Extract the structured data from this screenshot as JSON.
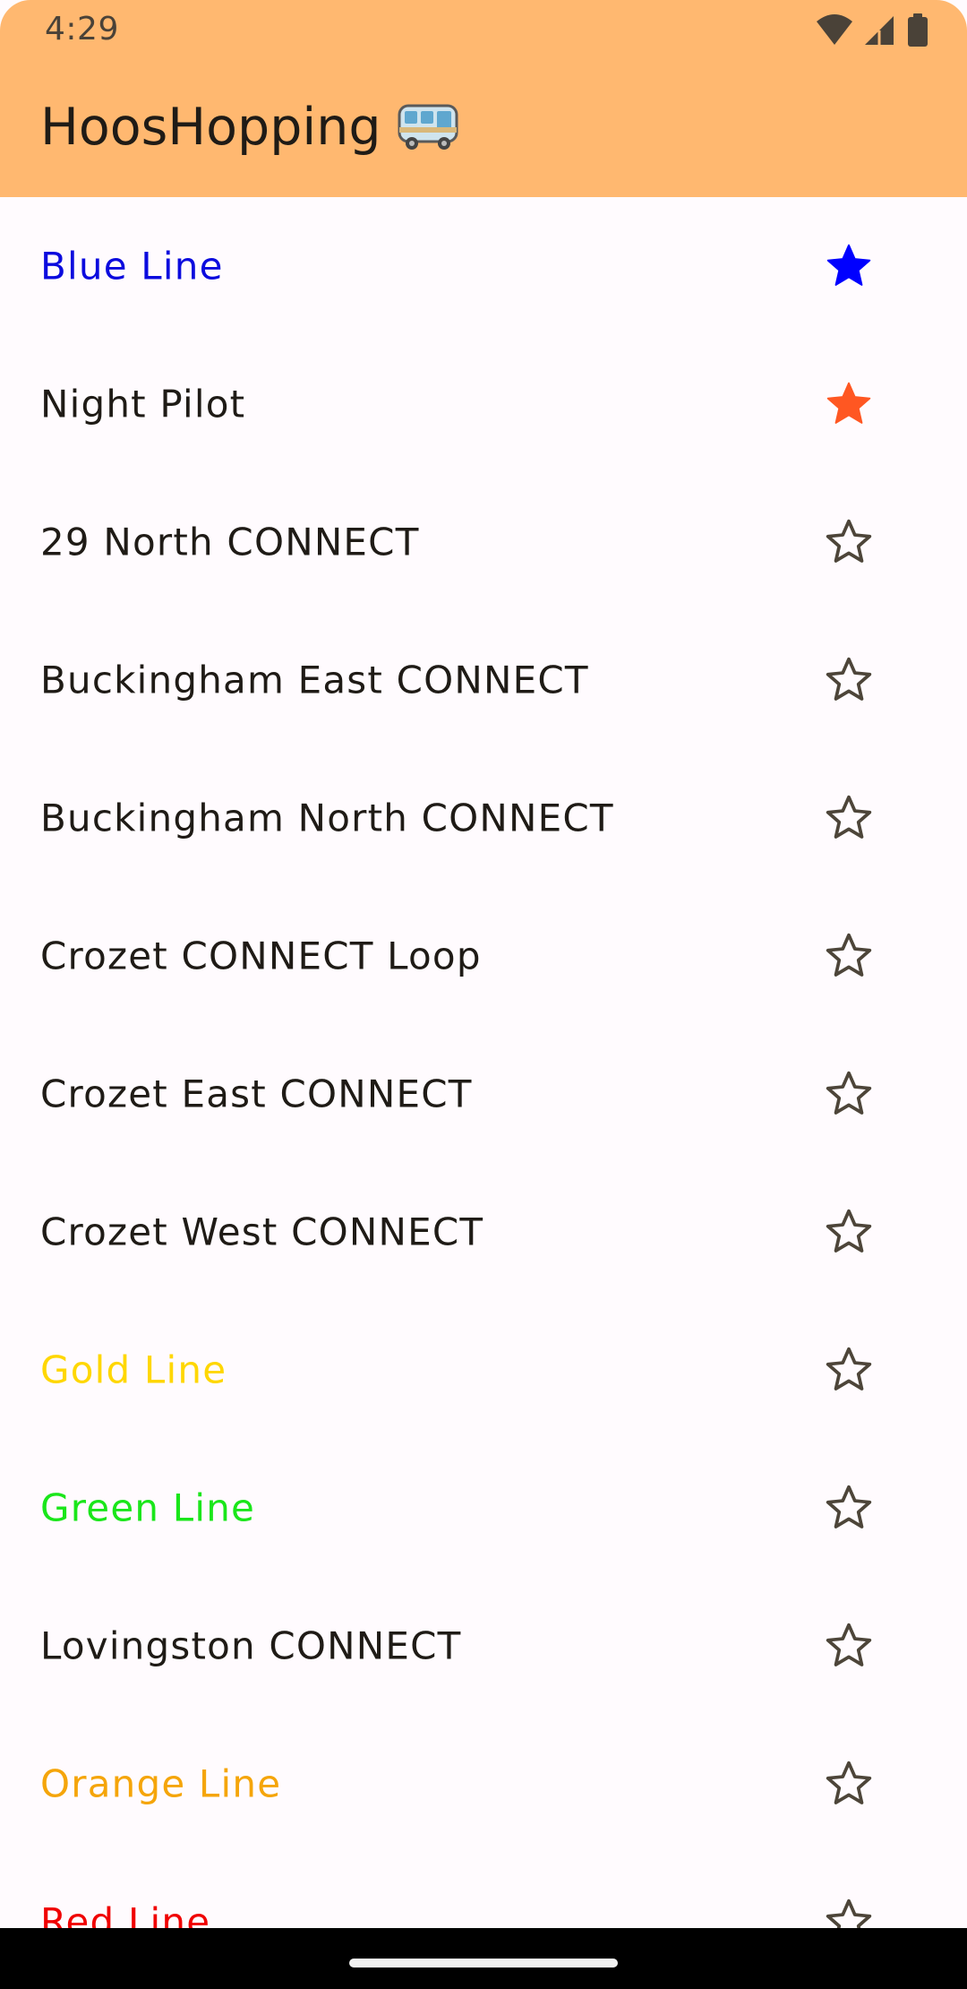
{
  "status_bar": {
    "time": "4:29",
    "icons": [
      "wifi-icon",
      "cellular-signal-icon",
      "battery-icon"
    ]
  },
  "app_bar": {
    "title": "HoosHopping",
    "title_icon": "bus-icon",
    "background": "#ffb870"
  },
  "routes": [
    {
      "name": "Blue Line",
      "color": "#0b0bde",
      "favorite": true,
      "star_color": "#0000ff"
    },
    {
      "name": "Night Pilot",
      "color": "#1f1b16",
      "favorite": true,
      "star_color": "#ff5722"
    },
    {
      "name": "29 North CONNECT",
      "color": "#1f1b16",
      "favorite": false
    },
    {
      "name": "Buckingham East CONNECT",
      "color": "#1f1b16",
      "favorite": false
    },
    {
      "name": "Buckingham North CONNECT",
      "color": "#1f1b16",
      "favorite": false
    },
    {
      "name": "Crozet CONNECT Loop",
      "color": "#1f1b16",
      "favorite": false
    },
    {
      "name": "Crozet East CONNECT",
      "color": "#1f1b16",
      "favorite": false
    },
    {
      "name": "Crozet West CONNECT",
      "color": "#1f1b16",
      "favorite": false
    },
    {
      "name": "Gold Line",
      "color": "#ffd700",
      "favorite": false
    },
    {
      "name": "Green Line",
      "color": "#1ae61a",
      "favorite": false
    },
    {
      "name": "Lovingston CONNECT",
      "color": "#1f1b16",
      "favorite": false
    },
    {
      "name": "Orange Line",
      "color": "#f5a50a",
      "favorite": false
    },
    {
      "name": "Red Line",
      "color": "#f00000",
      "favorite": false
    }
  ],
  "star_outline_color": "#4d4539",
  "nav_bar": {
    "background": "#000000",
    "handle": "home-handle"
  }
}
